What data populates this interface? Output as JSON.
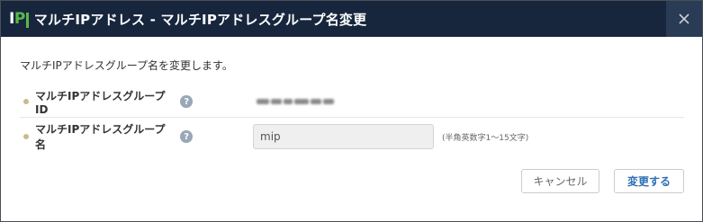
{
  "dialog": {
    "logo_i": "I",
    "logo_p": "P",
    "title": "マルチIPアドレス - マルチIPアドレスグループ名変更",
    "close_icon": "close-icon"
  },
  "content": {
    "description": "マルチIPアドレスグループ名を変更します。",
    "fields": [
      {
        "label": "マルチIPアドレスグループID",
        "help": "?",
        "value_obscured": true
      },
      {
        "label": "マルチIPアドレスグループ名",
        "help": "?",
        "input_value": "mip",
        "hint": "(半角英数字1～15文字)"
      }
    ]
  },
  "buttons": {
    "cancel": "キャンセル",
    "submit": "変更する"
  },
  "colors": {
    "titlebar": "#17263d",
    "logo_accent": "#59b84a",
    "submit_text": "#2f6fb3"
  }
}
